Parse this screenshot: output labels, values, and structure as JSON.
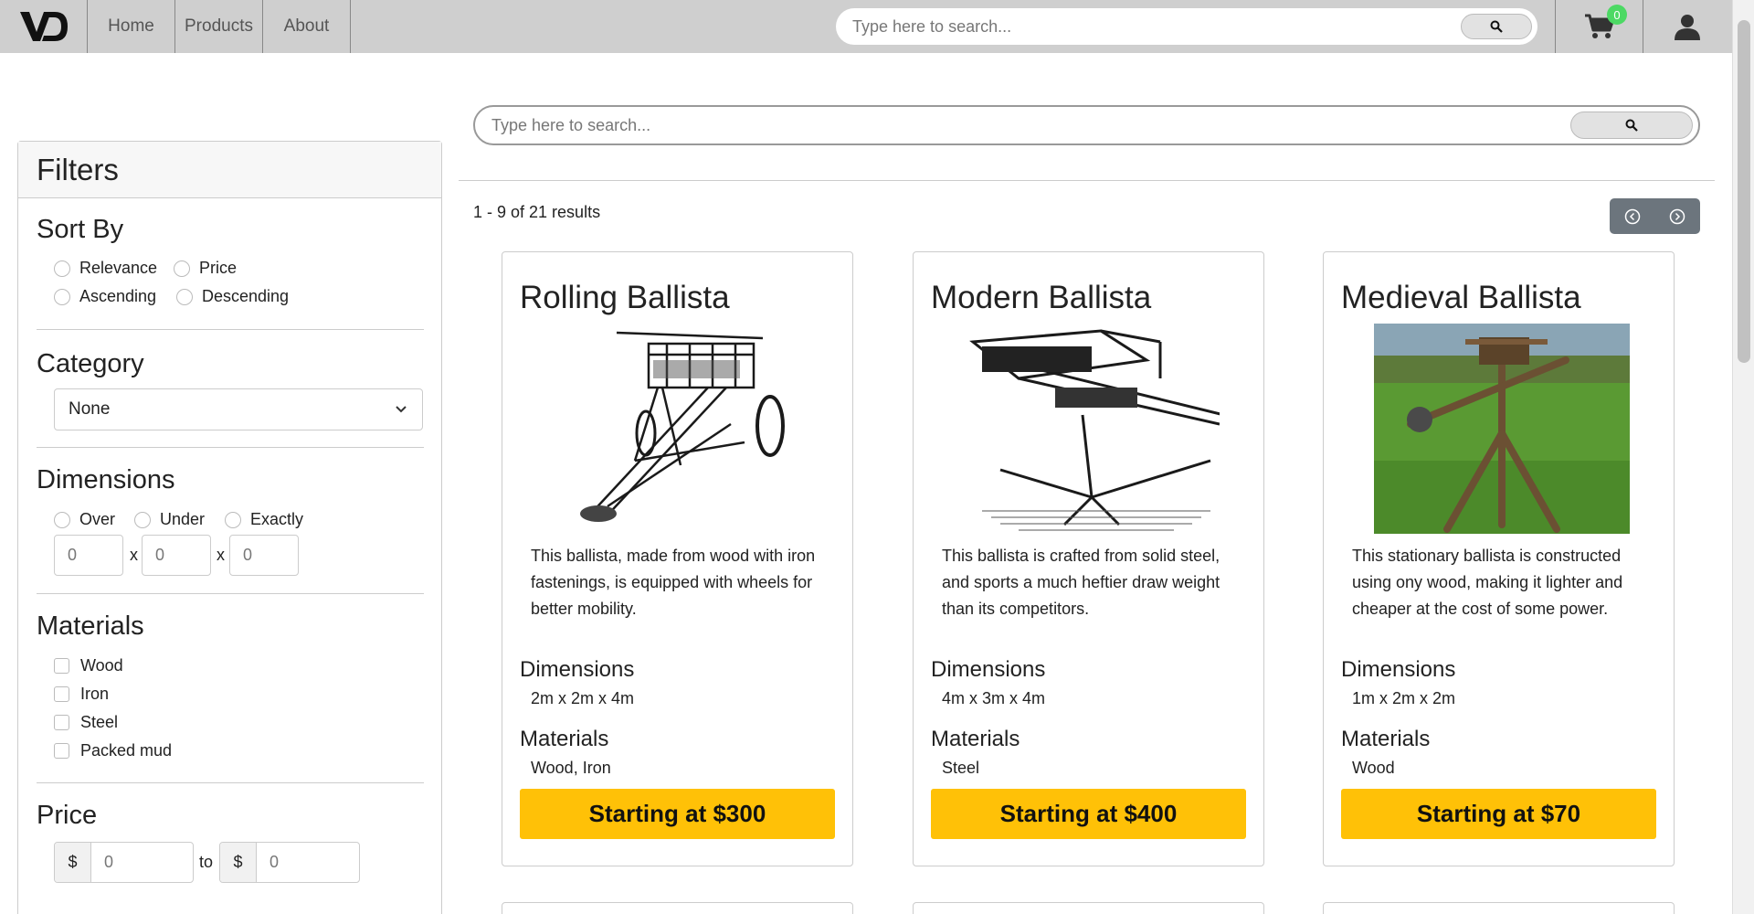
{
  "nav": {
    "logo_text": "VD",
    "links": [
      "Home",
      "Products",
      "About"
    ],
    "search_placeholder": "Type here to search...",
    "cart_count": "0"
  },
  "filters": {
    "title": "Filters",
    "sort_by": {
      "label": "Sort By",
      "options": [
        "Relevance",
        "Price",
        "Ascending",
        "Descending"
      ]
    },
    "category": {
      "label": "Category",
      "selected": "None"
    },
    "dimensions": {
      "label": "Dimensions",
      "options": [
        "Over",
        "Under",
        "Exactly"
      ],
      "values": [
        "0",
        "0",
        "0"
      ],
      "separator": "x"
    },
    "materials": {
      "label": "Materials",
      "options": [
        "Wood",
        "Iron",
        "Steel",
        "Packed mud"
      ]
    },
    "price": {
      "label": "Price",
      "currency": "$",
      "min": "0",
      "max": "0",
      "to_label": "to"
    }
  },
  "main": {
    "search_placeholder": "Type here to search...",
    "results_text": "1 - 9 of 21 results"
  },
  "products": [
    {
      "name": "Rolling Ballista",
      "description": "This ballista, made from wood with iron fastenings, is equipped with wheels for better mobility.",
      "dimensions_label": "Dimensions",
      "dimensions": "2m x 2m x 4m",
      "materials_label": "Materials",
      "materials": "Wood, Iron",
      "price_button": "Starting at $300"
    },
    {
      "name": "Modern Ballista",
      "description": "This ballista is crafted from solid steel, and sports a much heftier draw weight than its competitors.",
      "dimensions_label": "Dimensions",
      "dimensions": "4m x 3m x 4m",
      "materials_label": "Materials",
      "materials": "Steel",
      "price_button": "Starting at $400"
    },
    {
      "name": "Medieval Ballista",
      "description": "This stationary ballista is constructed using ony wood, making it lighter and cheaper at the cost of some power.",
      "dimensions_label": "Dimensions",
      "dimensions": "1m x 2m x 2m",
      "materials_label": "Materials",
      "materials": "Wood",
      "price_button": "Starting at $70"
    }
  ],
  "colors": {
    "navbar": "#cfcfcf",
    "accent_button": "#ffc107",
    "pager": "#6c757d",
    "cart_badge": "#4cd964"
  }
}
